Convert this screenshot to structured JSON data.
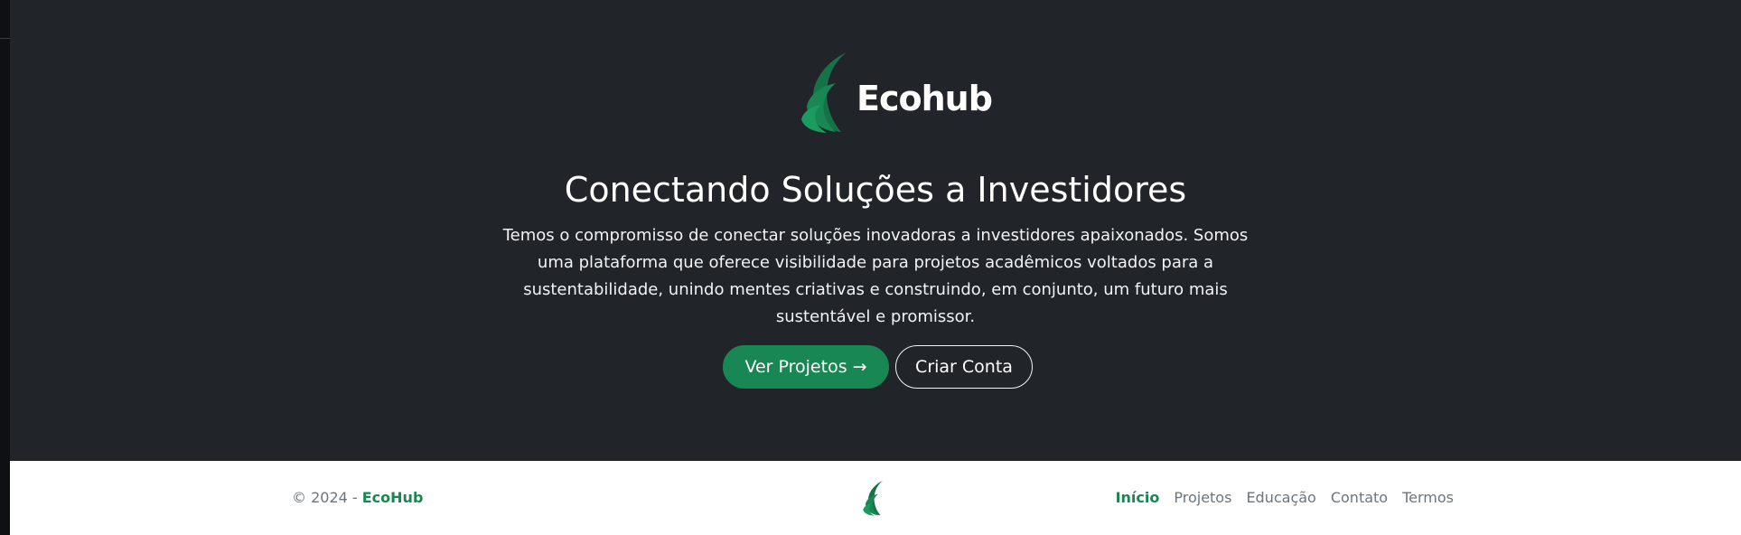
{
  "brand": {
    "logo_text": "Ecohub",
    "logo_icon": "leaf-swoosh-icon",
    "accent_color": "#198754"
  },
  "hero": {
    "title": "Conectando Soluções a Investidores",
    "description": "Temos o compromisso de conectar soluções inovadoras a investidores apaixonados. Somos uma plataforma que oferece visibilidade para projetos acadêmicos voltados para a sustentabilidade, unindo mentes criativas e construindo, em conjunto, um futuro mais sustentável e promissor.",
    "primary_button": {
      "label": "Ver Projetos",
      "icon": "arrow-right-icon",
      "arrow": "→"
    },
    "secondary_button": {
      "label": "Criar Conta"
    }
  },
  "footer": {
    "copyright_prefix": "© 2024 - ",
    "copyright_brand": "EcoHub",
    "logo_icon": "leaf-swoosh-icon",
    "nav": [
      {
        "label": "Início",
        "active": true
      },
      {
        "label": "Projetos",
        "active": false
      },
      {
        "label": "Educação",
        "active": false
      },
      {
        "label": "Contato",
        "active": false
      },
      {
        "label": "Termos",
        "active": false
      }
    ]
  },
  "colors": {
    "hero_bg": "#212529",
    "footer_bg": "#ffffff",
    "muted_text": "#6c757d"
  }
}
